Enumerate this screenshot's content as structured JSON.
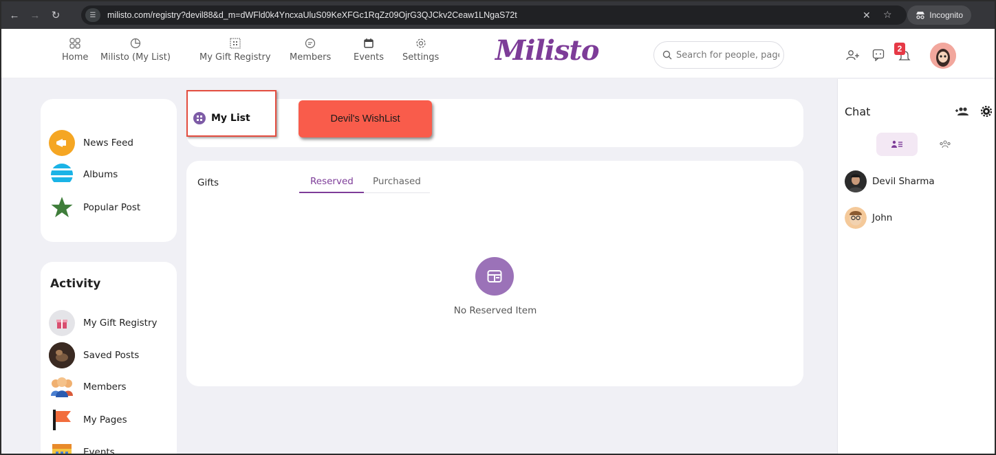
{
  "browser": {
    "url": "milisto.com/registry?devil88&d_m=dWFld0k4YncxaUluS09KeXFGc1RqZz09OjrG3QJCkv2Ceaw1LNgaS72t",
    "incognito_label": "Incognito"
  },
  "header": {
    "logo": "Milisto",
    "nav": [
      {
        "label": "Home",
        "icon": "grid-icon"
      },
      {
        "label": "Milisto (My List)",
        "icon": "pie-chart-icon"
      },
      {
        "label": "My Gift Registry",
        "icon": "qr-grid-icon"
      },
      {
        "label": "Members",
        "icon": "chat-bubble-icon"
      },
      {
        "label": "Events",
        "icon": "calendar-icon"
      },
      {
        "label": "Settings",
        "icon": "gear-icon"
      }
    ],
    "search_placeholder": "Search for people, pages",
    "notification_count": "2"
  },
  "sidebar": {
    "top_items": [
      {
        "label": "News Feed",
        "icon": "megaphone-icon",
        "color": "#f5a623"
      },
      {
        "label": "Albums",
        "icon": "stripes-icon",
        "color": "#1ab3e6"
      },
      {
        "label": "Popular Post",
        "icon": "star-icon",
        "color": "#3f7d3a"
      }
    ],
    "activity_title": "Activity",
    "activity_items": [
      {
        "label": "My Gift Registry",
        "icon": "gift-registry-icon"
      },
      {
        "label": "Saved Posts",
        "icon": "saved-posts-icon"
      },
      {
        "label": "Members",
        "icon": "members-icon"
      },
      {
        "label": "My Pages",
        "icon": "flag-icon"
      },
      {
        "label": "Events",
        "icon": "calendar-icon"
      }
    ]
  },
  "main": {
    "my_list_label": "My List",
    "wishlist_button": "Devil's WishList",
    "gifts_label": "Gifts",
    "tabs": [
      {
        "label": "Reserved",
        "active": true
      },
      {
        "label": "Purchased",
        "active": false
      }
    ],
    "empty_message": "No Reserved Item"
  },
  "chat": {
    "title": "Chat",
    "users": [
      {
        "name": "Devil Sharma"
      },
      {
        "name": "John"
      }
    ]
  },
  "colors": {
    "accent": "#7d3c98",
    "wishlist_button": "#f95c4b",
    "highlight_border": "#e34c3e"
  }
}
